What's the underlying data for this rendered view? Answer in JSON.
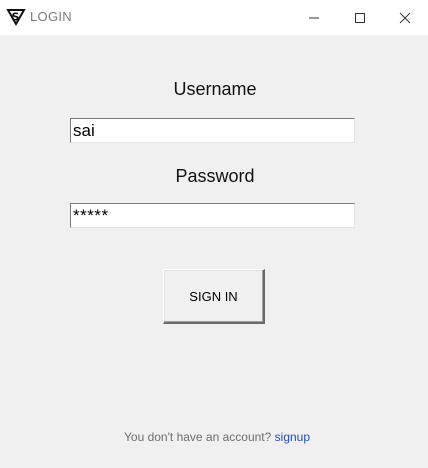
{
  "window": {
    "title": "LOGIN",
    "controls": [
      "minimize-icon",
      "maximize-icon",
      "close-icon"
    ]
  },
  "form": {
    "username_label": "Username",
    "username_value": "sai",
    "password_label": "Password",
    "password_value": "*****",
    "signin_label": "SIGN IN"
  },
  "footer": {
    "prompt": "You don't have an account?",
    "signup_label": "signup"
  },
  "colors": {
    "background": "#f0f0f0",
    "titlebar": "#ffffff",
    "link": "#1f4fbf"
  }
}
